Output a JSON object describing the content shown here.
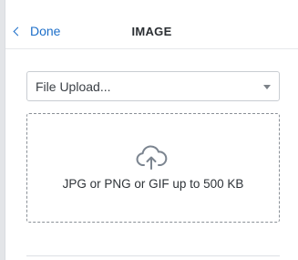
{
  "header": {
    "back_label": "Done",
    "title": "IMAGE"
  },
  "source_select": {
    "selected": "File Upload..."
  },
  "dropzone": {
    "hint": "JPG or PNG or GIF up to 500 KB",
    "icon": "cloud-upload-icon"
  },
  "colors": {
    "link": "#1d6fc9",
    "icon": "#7c8590",
    "border": "#c9cdd2"
  }
}
